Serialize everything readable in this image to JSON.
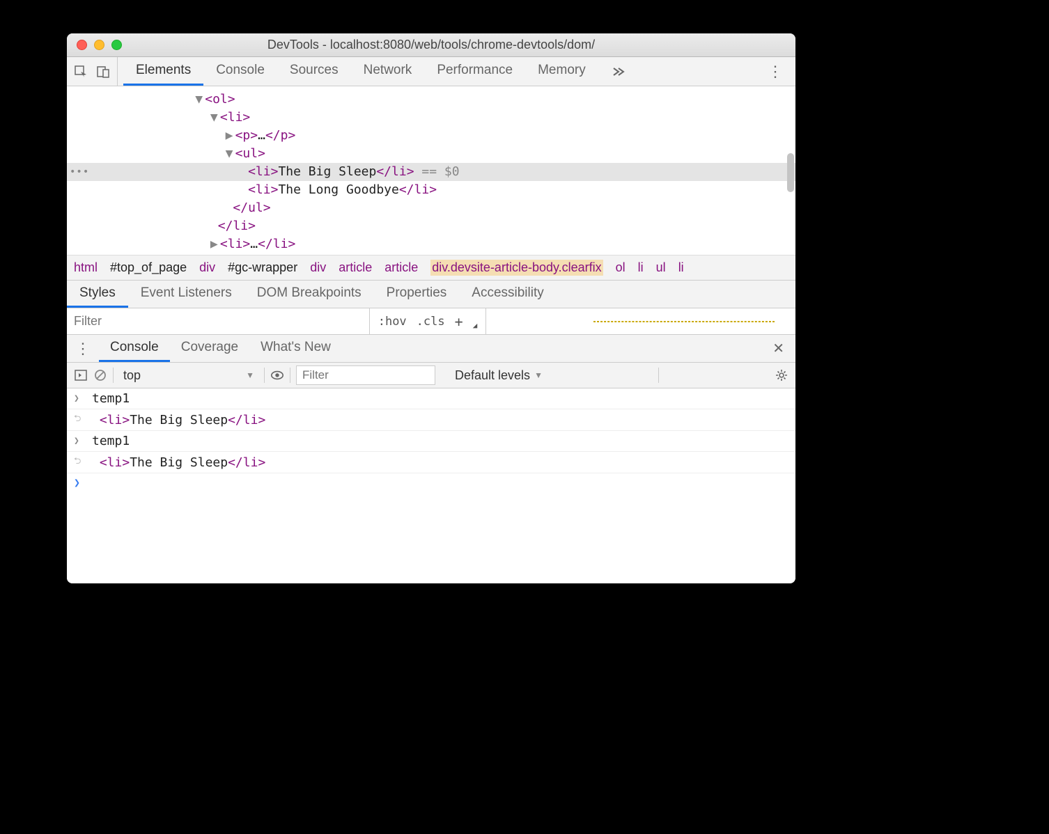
{
  "window_title": "DevTools - localhost:8080/web/tools/chrome-devtools/dom/",
  "main_tabs": [
    "Elements",
    "Console",
    "Sources",
    "Network",
    "Performance",
    "Memory"
  ],
  "main_tab_active": "Elements",
  "dom": {
    "line1_tag": "<ol>",
    "line2_tag": "<li>",
    "line3_open": "<p>",
    "line3_dots": "…",
    "line3_close": "</p>",
    "line4_tag": "<ul>",
    "line5_open": "<li>",
    "line5_text": "The Big Sleep",
    "line5_close": "</li>",
    "line5_suffix": " == $0",
    "line6_open": "<li>",
    "line6_text": "The Long Goodbye",
    "line6_close": "</li>",
    "line7_tag": "</ul>",
    "line8_tag": "</li>",
    "line9_open": "<li>",
    "line9_dots": "…",
    "line9_close": "</li>"
  },
  "crumbs": [
    "html",
    "#top_of_page",
    "div",
    "#gc-wrapper",
    "div",
    "article",
    "article",
    "div.devsite-article-body.clearfix",
    "ol",
    "li",
    "ul",
    "li"
  ],
  "crumb_highlight_index": 7,
  "subtabs": [
    "Styles",
    "Event Listeners",
    "DOM Breakpoints",
    "Properties",
    "Accessibility"
  ],
  "subtab_active": "Styles",
  "styles_filter_placeholder": "Filter",
  "hov": ":hov",
  "cls": ".cls",
  "drawer_tabs": [
    "Console",
    "Coverage",
    "What's New"
  ],
  "drawer_tab_active": "Console",
  "console_toolbar": {
    "context": "top",
    "filter_placeholder": "Filter",
    "levels": "Default levels"
  },
  "console_rows": [
    {
      "type": "input",
      "text": "temp1"
    },
    {
      "type": "output",
      "tag_open": "<li>",
      "text": "The Big Sleep",
      "tag_close": "</li>"
    },
    {
      "type": "input",
      "text": "temp1"
    },
    {
      "type": "output",
      "tag_open": "<li>",
      "text": "The Big Sleep",
      "tag_close": "</li>"
    }
  ]
}
